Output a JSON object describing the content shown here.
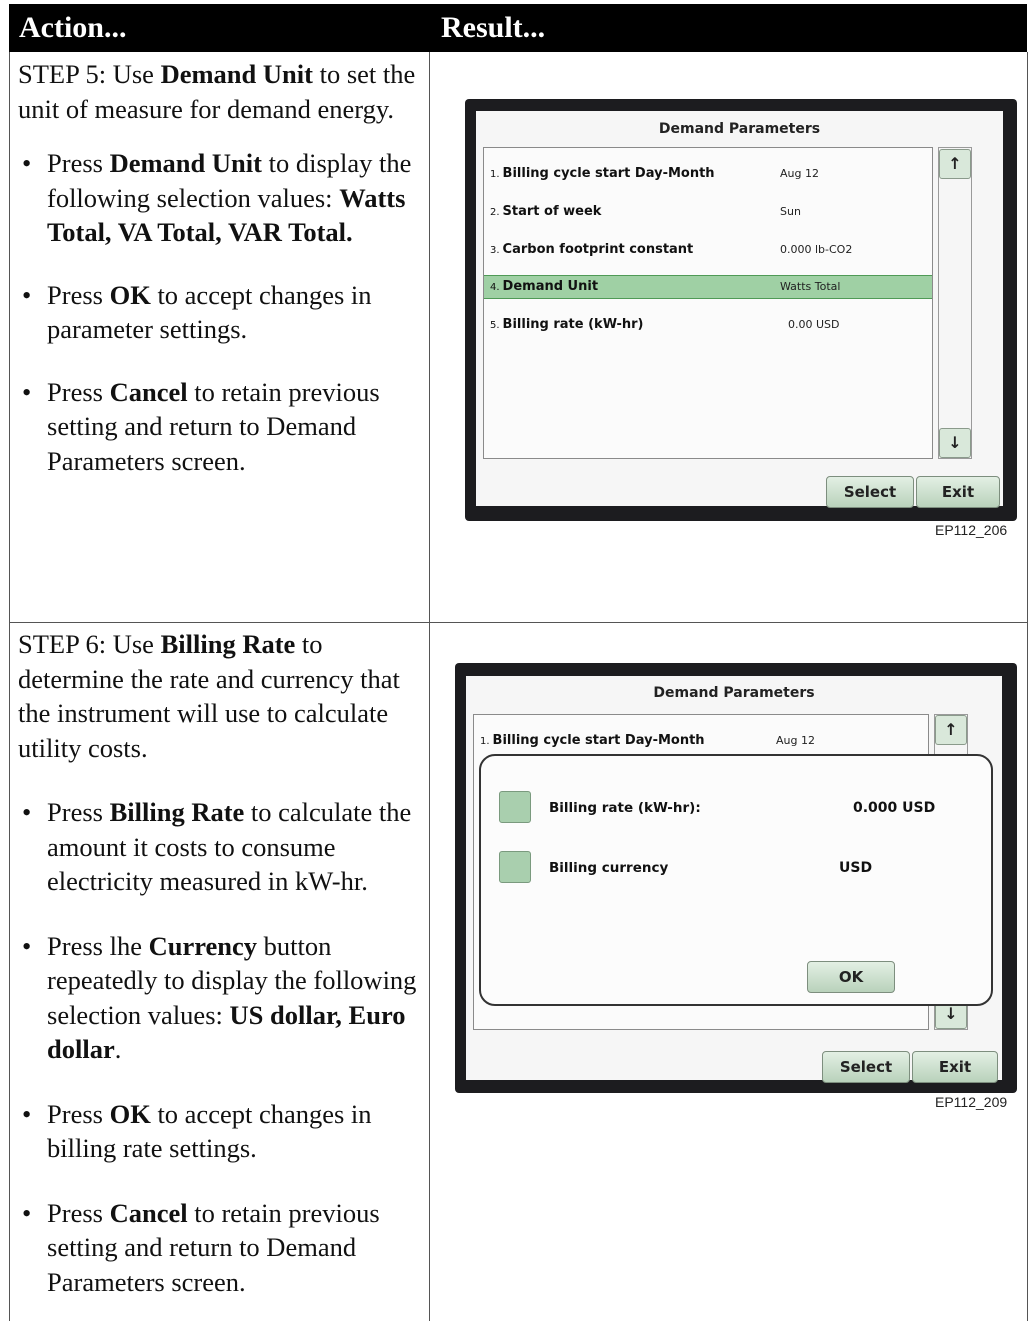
{
  "header": {
    "action": "Action...",
    "result": "Result..."
  },
  "step5": {
    "intro": [
      {
        "t": "STEP 5: Use ",
        "b": false
      },
      {
        "t": "Demand Unit",
        "b": true
      },
      {
        "t": " to set the unit of measure for demand energy.",
        "b": false
      }
    ],
    "bullets": [
      [
        {
          "t": "Press ",
          "b": false
        },
        {
          "t": "Demand Unit",
          "b": true
        },
        {
          "t": " to display the following selection values: ",
          "b": false
        },
        {
          "t": "Watts Total, VA Total, VAR Total.",
          "b": true
        }
      ],
      [
        {
          "t": "Press ",
          "b": false
        },
        {
          "t": "OK",
          "b": true
        },
        {
          "t": " to accept changes in parameter settings.",
          "b": false
        }
      ],
      [
        {
          "t": "Press ",
          "b": false
        },
        {
          "t": "Cancel",
          "b": true
        },
        {
          "t": " to retain previous setting and return to Demand Parameters screen.",
          "b": false
        }
      ]
    ],
    "screen": {
      "title": "Demand Parameters",
      "rows": [
        {
          "num": "1.",
          "label": "Billing cycle start Day-Month",
          "value": "Aug 12",
          "selected": false
        },
        {
          "num": "2.",
          "label": "Start of week",
          "value": "Sun",
          "selected": false
        },
        {
          "num": "3.",
          "label": "Carbon footprint constant",
          "value": "0.000 lb-CO2",
          "selected": false
        },
        {
          "num": "4.",
          "label": "Demand Unit",
          "value": "Watts Total",
          "selected": true
        },
        {
          "num": "5.",
          "label": "Billing rate (kW-hr)",
          "value": "0.00 USD",
          "selected": false
        }
      ],
      "up": "↑",
      "down": "↓",
      "select_button": "Select",
      "exit_button": "Exit"
    },
    "figure_id": "EP112_206"
  },
  "step6": {
    "intro": [
      {
        "t": "STEP 6: Use ",
        "b": false
      },
      {
        "t": "Billing Rate",
        "b": true
      },
      {
        "t": " to determine the rate and currency that the instrument will use to calculate utility costs.",
        "b": false
      }
    ],
    "bullets": [
      [
        {
          "t": "Press ",
          "b": false
        },
        {
          "t": "Billing Rate",
          "b": true
        },
        {
          "t": " to calculate the amount it costs to consume electricity measured in kW-hr.",
          "b": false
        }
      ],
      [
        {
          "t": "Press  lhe ",
          "b": false
        },
        {
          "t": "Currency",
          "b": true
        },
        {
          "t": " button repeatedly to display the following selection values: ",
          "b": false
        },
        {
          "t": "US dollar, Euro dollar",
          "b": true
        },
        {
          "t": ".",
          "b": false
        }
      ],
      [
        {
          "t": "Press ",
          "b": false
        },
        {
          "t": "OK",
          "b": true
        },
        {
          "t": " to accept changes in billing rate settings.",
          "b": false
        }
      ],
      [
        {
          "t": "Press ",
          "b": false
        },
        {
          "t": "Cancel",
          "b": true
        },
        {
          "t": " to retain previous setting and return to Demand Parameters screen.",
          "b": false
        }
      ]
    ],
    "screen": {
      "title": "Demand Parameters",
      "row1_num": "1.",
      "row1_label": "Billing cycle start Day-Month",
      "row1_value": "Aug 12",
      "up": "↑",
      "down": "↓",
      "dialog": {
        "rate_label": "Billing rate (kW-hr):",
        "rate_value": "0.000 USD",
        "currency_label": "Billing currency",
        "currency_value": "USD",
        "ok_button": "OK"
      },
      "select_button": "Select",
      "exit_button": "Exit"
    },
    "figure_id": "EP112_209"
  }
}
